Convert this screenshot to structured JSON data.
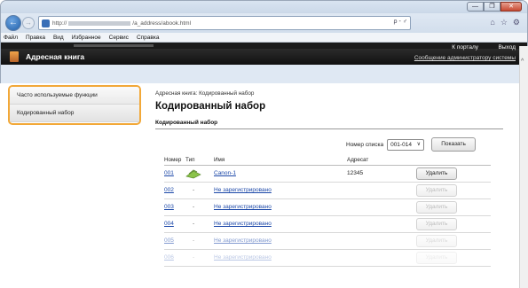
{
  "browser": {
    "address_prefix": "http://",
    "address_suffix": "/a_address/abook.html",
    "search_glyph": "ρ - ♂",
    "menu": [
      "Файл",
      "Правка",
      "Вид",
      "Избранное",
      "Сервис",
      "Справка"
    ],
    "window_controls": {
      "min": "—",
      "max": "❐",
      "close": "✕"
    }
  },
  "header": {
    "title": "Адресная книга",
    "portal_link": "К порталу",
    "logout_link": "Выход",
    "admin_message": "Сообщение администратору системы"
  },
  "sidebar": {
    "items": [
      {
        "label": "Часто используемые функции"
      },
      {
        "label": "Кодированный набор"
      }
    ]
  },
  "main": {
    "breadcrumb": "Адресная книга: Кодированный набор",
    "title": "Кодированный набор",
    "section_title": "Кодированный набор",
    "list_label": "Номер списка",
    "list_value": "001-014",
    "show_button": "Показать",
    "columns": {
      "number": "Номер",
      "type": "Тип",
      "name": "Имя",
      "destination": "Адресат"
    },
    "rows": [
      {
        "number": "001",
        "type": "fax-icon",
        "name": "Canon-1",
        "destination": "12345",
        "action": "Удалить",
        "enabled": true
      },
      {
        "number": "002",
        "type": "-",
        "name": "Не зарегистрировано",
        "destination": "",
        "action": "Удалить",
        "enabled": false
      },
      {
        "number": "003",
        "type": "-",
        "name": "Не зарегистрировано",
        "destination": "",
        "action": "Удалить",
        "enabled": false
      },
      {
        "number": "004",
        "type": "-",
        "name": "Не зарегистрировано",
        "destination": "",
        "action": "Удалить",
        "enabled": false
      },
      {
        "number": "005",
        "type": "-",
        "name": "Не зарегистрировано",
        "destination": "",
        "action": "Удалить",
        "enabled": false
      },
      {
        "number": "006",
        "type": "-",
        "name": "Не зарегистрировано",
        "destination": "",
        "action": "Удалить",
        "enabled": false
      }
    ]
  },
  "colors": {
    "highlight": "#f2a838",
    "link": "#1b47a8",
    "header_bg": "#1b1b1b"
  }
}
